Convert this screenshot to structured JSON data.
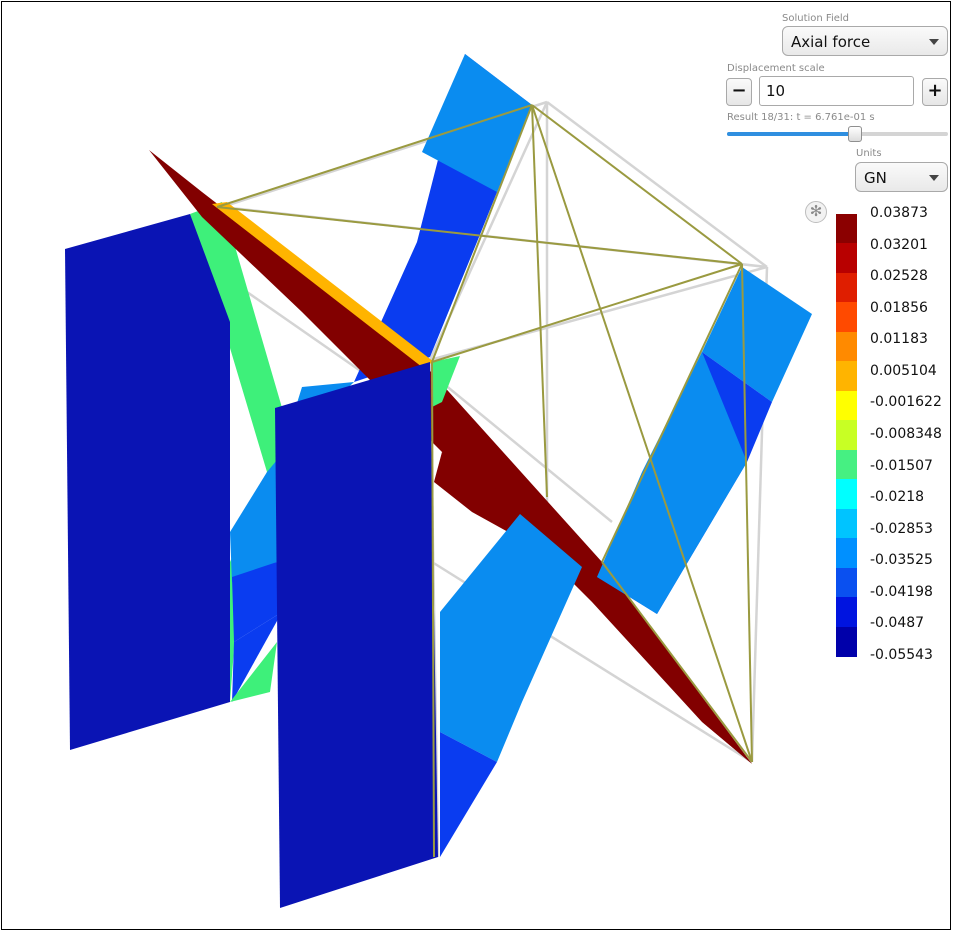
{
  "controls": {
    "solution_field": {
      "label": "Solution Field",
      "value": "Axial force"
    },
    "displacement_scale": {
      "label": "Displacement scale",
      "value": "10",
      "minus_label": "−",
      "plus_label": "+"
    },
    "result": {
      "text": "Result 18/31: t = 6.761e-01 s",
      "step": 18,
      "total": 31,
      "position": 0.58
    },
    "units": {
      "label": "Units",
      "value": "GN"
    },
    "settings_icon": "gear-icon"
  },
  "legend": {
    "labels": [
      "0.03873",
      "0.03201",
      "0.02528",
      "0.01856",
      "0.01183",
      "0.005104",
      "-0.001622",
      "-0.008348",
      "-0.01507",
      "-0.0218",
      "-0.02853",
      "-0.03525",
      "-0.04198",
      "-0.0487",
      "-0.05543"
    ],
    "colors": [
      "#8b0000",
      "#b80000",
      "#df1e00",
      "#ff4a00",
      "#ff8a00",
      "#ffb400",
      "#ffff00",
      "#c8ff24",
      "#46f082",
      "#00ffff",
      "#00c4ff",
      "#0090ff",
      "#0a50f0",
      "#0014e0",
      "#0000aa"
    ]
  },
  "scene": {
    "colors": {
      "dark_blue": "#0a14b4",
      "blue": "#0a3cf0",
      "light_blue": "#0a8cf0",
      "green": "#3ef07a",
      "orange": "#ffb400",
      "dark_red": "#820000",
      "wire_yellow": "#c8c84a",
      "wire_gray": "#c8c8c8"
    }
  }
}
